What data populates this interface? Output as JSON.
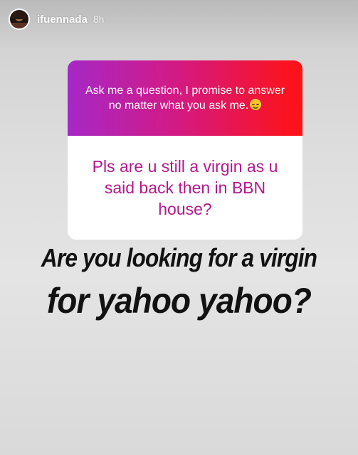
{
  "header": {
    "username": "ifuennada",
    "time": "8h"
  },
  "question_sticker": {
    "prompt": "Ask me a question, I promise to answer no matter what you ask me.",
    "emoji_icon": "smiling-face-emoji",
    "question": "Pls are u still a virgin as u said back then in BBN house?",
    "gradient_colors": [
      "#a528c6",
      "#ff1212"
    ],
    "question_color": "#b3188e"
  },
  "caption": {
    "line1": "Are you looking for a virgin",
    "line2": "for yahoo yahoo?"
  }
}
